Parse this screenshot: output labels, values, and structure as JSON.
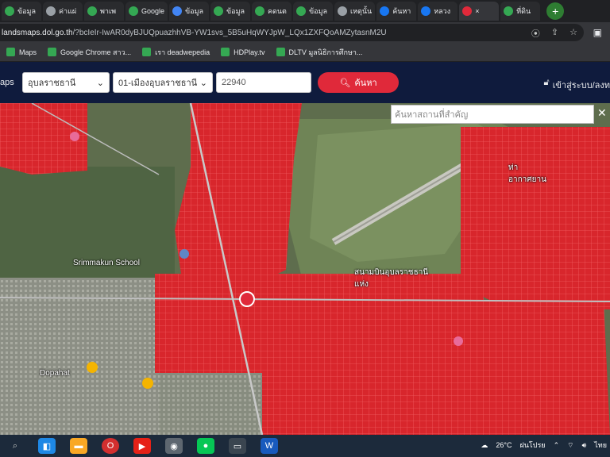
{
  "tabs": [
    {
      "label": "ข้อมูล",
      "icon": "green-globe-icon"
    },
    {
      "label": "ค่าแผ่",
      "icon": "gray-globe-icon"
    },
    {
      "label": "พาเพ",
      "icon": "green-globe-icon"
    },
    {
      "label": "Google",
      "icon": "map-pin-icon"
    },
    {
      "label": "ข้อมูล",
      "icon": "blue-pin-icon"
    },
    {
      "label": "ข้อมูล",
      "icon": "green-globe-icon"
    },
    {
      "label": "คดนต",
      "icon": "green-globe-icon"
    },
    {
      "label": "ข้อมูล",
      "icon": "green-globe-icon"
    },
    {
      "label": "เหตุนั้น",
      "icon": "gray-globe-icon"
    },
    {
      "label": "ค้นหา",
      "icon": "facebook-icon"
    },
    {
      "label": "หลวง",
      "icon": "facebook-icon"
    },
    {
      "label": "×",
      "icon": "red-pin-icon"
    },
    {
      "label": "ที่ดิน",
      "icon": "green-globe-icon"
    }
  ],
  "address": {
    "host": "landsmaps.dol.go.th",
    "path": "/?bcIeIr-IwAR0dyBJUQpuazhhVB-YW1svs_5B5uHqWYJpW_LQx1ZXFQoAMZytasnM2U"
  },
  "bookmarks": [
    {
      "label": "Maps"
    },
    {
      "label": "Google Chrome สาว..."
    },
    {
      "label": "เรา deadwepedia"
    },
    {
      "label": "HDPlay.tv"
    },
    {
      "label": "DLTV มูลนิธิการศึกษา..."
    }
  ],
  "appbar": {
    "brand": "aps",
    "province": "อุบลราชธานี",
    "district": "01-เมืองอุบลราชธานี",
    "parcel": "22940",
    "search_label": "ค้นหา",
    "login_label": "เข้าสู่ระบบ/ลงท"
  },
  "map": {
    "poi_placeholder": "ค้นหาสถานที่สำคัญ",
    "labels": {
      "school": "Srimmakun School",
      "place1": "Dopahat",
      "place2": "ท่าอากาศยาน",
      "place3": "สนามบินอุบลราชธานี แห่ง"
    }
  },
  "taskbar": {
    "weather": "26°C",
    "weather_desc": "ฝนโปรย",
    "lang": "ไทย"
  }
}
